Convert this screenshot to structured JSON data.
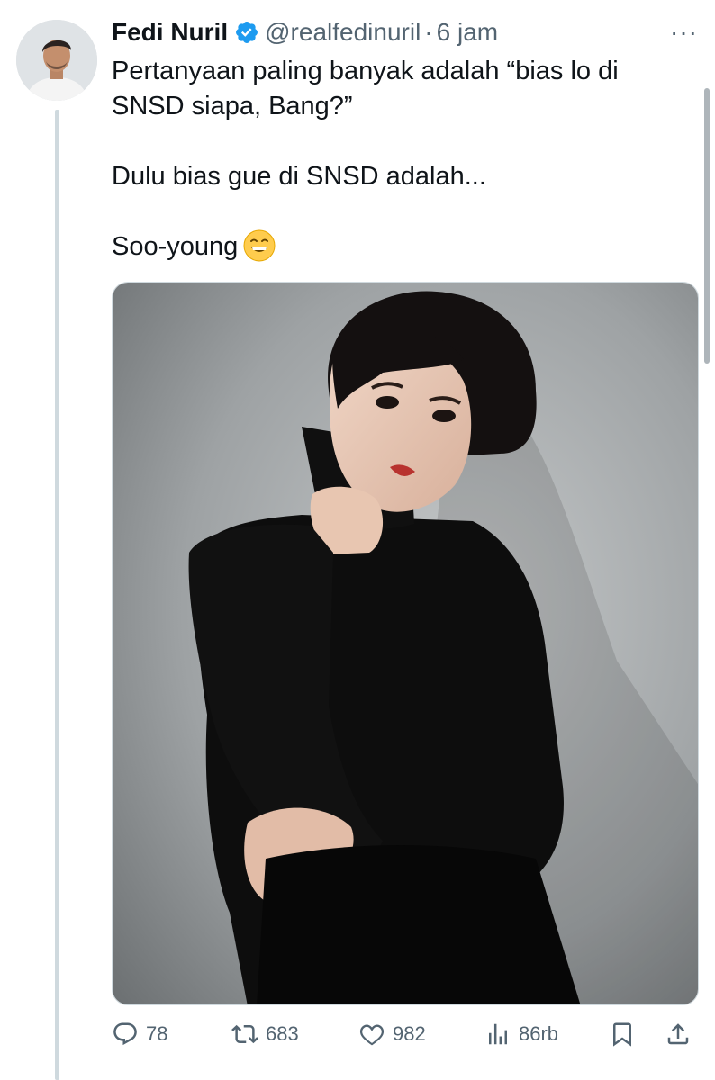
{
  "tweet": {
    "author_name": "Fedi Nuril",
    "handle": "@realfedinuril",
    "separator": "·",
    "time": "6 jam",
    "more_label": "···",
    "text_lines": [
      "Pertanyaan paling banyak adalah “bias lo di SNSD siapa, Bang?”",
      "Dulu bias gue di SNSD adalah...",
      "Soo-young"
    ],
    "emoji": "grinning-face-with-smiling-eyes"
  },
  "actions": {
    "replies": "78",
    "reposts": "683",
    "likes": "982",
    "views": "86rb"
  },
  "icons": [
    "verified-badge-icon",
    "more-icon",
    "reply-icon",
    "repost-icon",
    "like-icon",
    "views-icon",
    "bookmark-icon",
    "share-icon"
  ],
  "colors": {
    "text": "#0f1419",
    "secondary": "#536471",
    "verified": "#1d9bf0",
    "thread_line": "#cfd9de"
  }
}
